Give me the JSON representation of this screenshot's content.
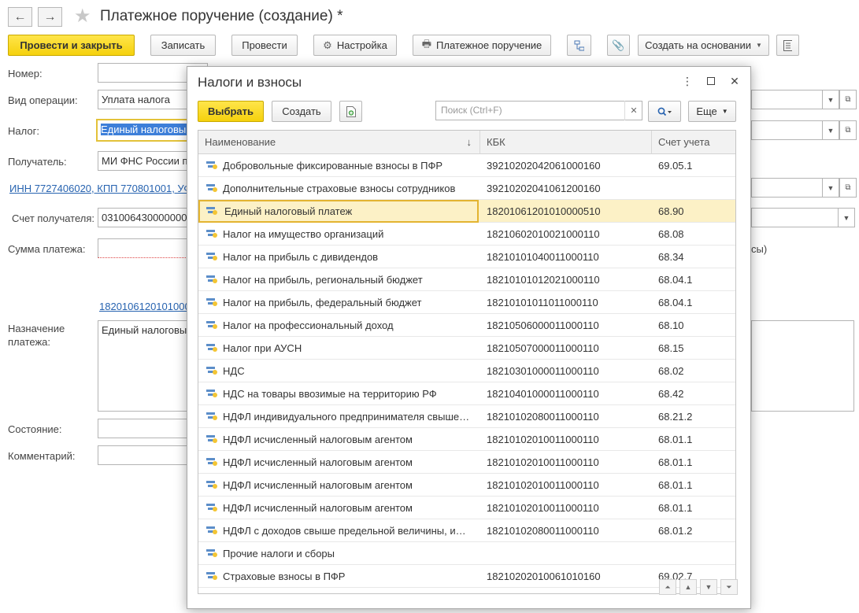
{
  "header": {
    "title": "Платежное поручение (создание) *",
    "back_icon": "←",
    "forward_icon": "→",
    "star_icon": "★"
  },
  "toolbar": {
    "post_close": "Провести и закрыть",
    "save": "Записать",
    "post": "Провести",
    "settings": "Настройка",
    "payment_order": "Платежное поручение",
    "create_based_on": "Создать на основании"
  },
  "form": {
    "number_label": "Номер:",
    "number_value": "",
    "operation_label": "Вид операции:",
    "operation_value": "Уплата налога",
    "tax_label": "Налог:",
    "tax_value": "Единый налоговый",
    "recipient_label": "Получатель:",
    "recipient_value": "МИ ФНС России п",
    "inn_link": "ИНН 7727406020, КПП 770801001, УФ",
    "account_label": "Счет получателя:",
    "account_value": "031006430000000",
    "sum_label": "Сумма платежа:",
    "sum_value": "",
    "sum_suffix": "сы)",
    "kbk_link": "1820106120101000",
    "purpose_label": "Назначение платежа:",
    "purpose_value": "Единый налоговый",
    "state_label": "Состояние:",
    "state_value": "",
    "comment_label": "Комментарий:",
    "comment_value": ""
  },
  "dialog": {
    "title": "Налоги и взносы",
    "select": "Выбрать",
    "create": "Создать",
    "search_placeholder": "Поиск (Ctrl+F)",
    "more": "Еще",
    "columns": {
      "name": "Наименование",
      "kbk": "КБК",
      "account": "Счет учета",
      "sort_icon": "↓"
    },
    "rows": [
      {
        "name": "Добровольные фиксированные взносы в ПФР",
        "kbk": "39210202042061000160",
        "account": "69.05.1"
      },
      {
        "name": "Дополнительные страховые взносы сотрудников",
        "kbk": "39210202041061200160",
        "account": ""
      },
      {
        "name": "Единый налоговый платеж",
        "kbk": "18201061201010000510",
        "account": "68.90",
        "selected": true
      },
      {
        "name": "Налог на имущество организаций",
        "kbk": "18210602010021000110",
        "account": "68.08"
      },
      {
        "name": "Налог на прибыль с дивидендов",
        "kbk": "18210101040011000110",
        "account": "68.34"
      },
      {
        "name": "Налог на прибыль, региональный бюджет",
        "kbk": "18210101012021000110",
        "account": "68.04.1"
      },
      {
        "name": "Налог на прибыль, федеральный бюджет",
        "kbk": "18210101011011000110",
        "account": "68.04.1"
      },
      {
        "name": "Налог на профессиональный доход",
        "kbk": "18210506000011000110",
        "account": "68.10"
      },
      {
        "name": "Налог при АУСН",
        "kbk": "18210507000011000110",
        "account": "68.15"
      },
      {
        "name": "НДС",
        "kbk": "18210301000011000110",
        "account": "68.02"
      },
      {
        "name": "НДС на товары ввозимые на территорию РФ",
        "kbk": "18210401000011000110",
        "account": "68.42"
      },
      {
        "name": "НДФЛ индивидуального предпринимателя свыше…",
        "kbk": "18210102080011000110",
        "account": "68.21.2"
      },
      {
        "name": "НДФЛ исчисленный налоговым агентом",
        "kbk": "18210102010011000110",
        "account": "68.01.1"
      },
      {
        "name": "НДФЛ исчисленный налоговым агентом",
        "kbk": "18210102010011000110",
        "account": "68.01.1"
      },
      {
        "name": "НДФЛ исчисленный налоговым агентом",
        "kbk": "18210102010011000110",
        "account": "68.01.1"
      },
      {
        "name": "НДФЛ исчисленный налоговым агентом",
        "kbk": "18210102010011000110",
        "account": "68.01.1"
      },
      {
        "name": "НДФЛ с доходов свыше предельной величины, и…",
        "kbk": "18210102080011000110",
        "account": "68.01.2"
      },
      {
        "name": "Прочие налоги и сборы",
        "kbk": "",
        "account": ""
      },
      {
        "name": "Страховые взносы в ПФР",
        "kbk": "18210202010061010160",
        "account": "69.02.7"
      }
    ]
  },
  "colors": {
    "primary_button": "#f5d10d",
    "link": "#2763b0",
    "selected_row": "#fcf1c6"
  }
}
